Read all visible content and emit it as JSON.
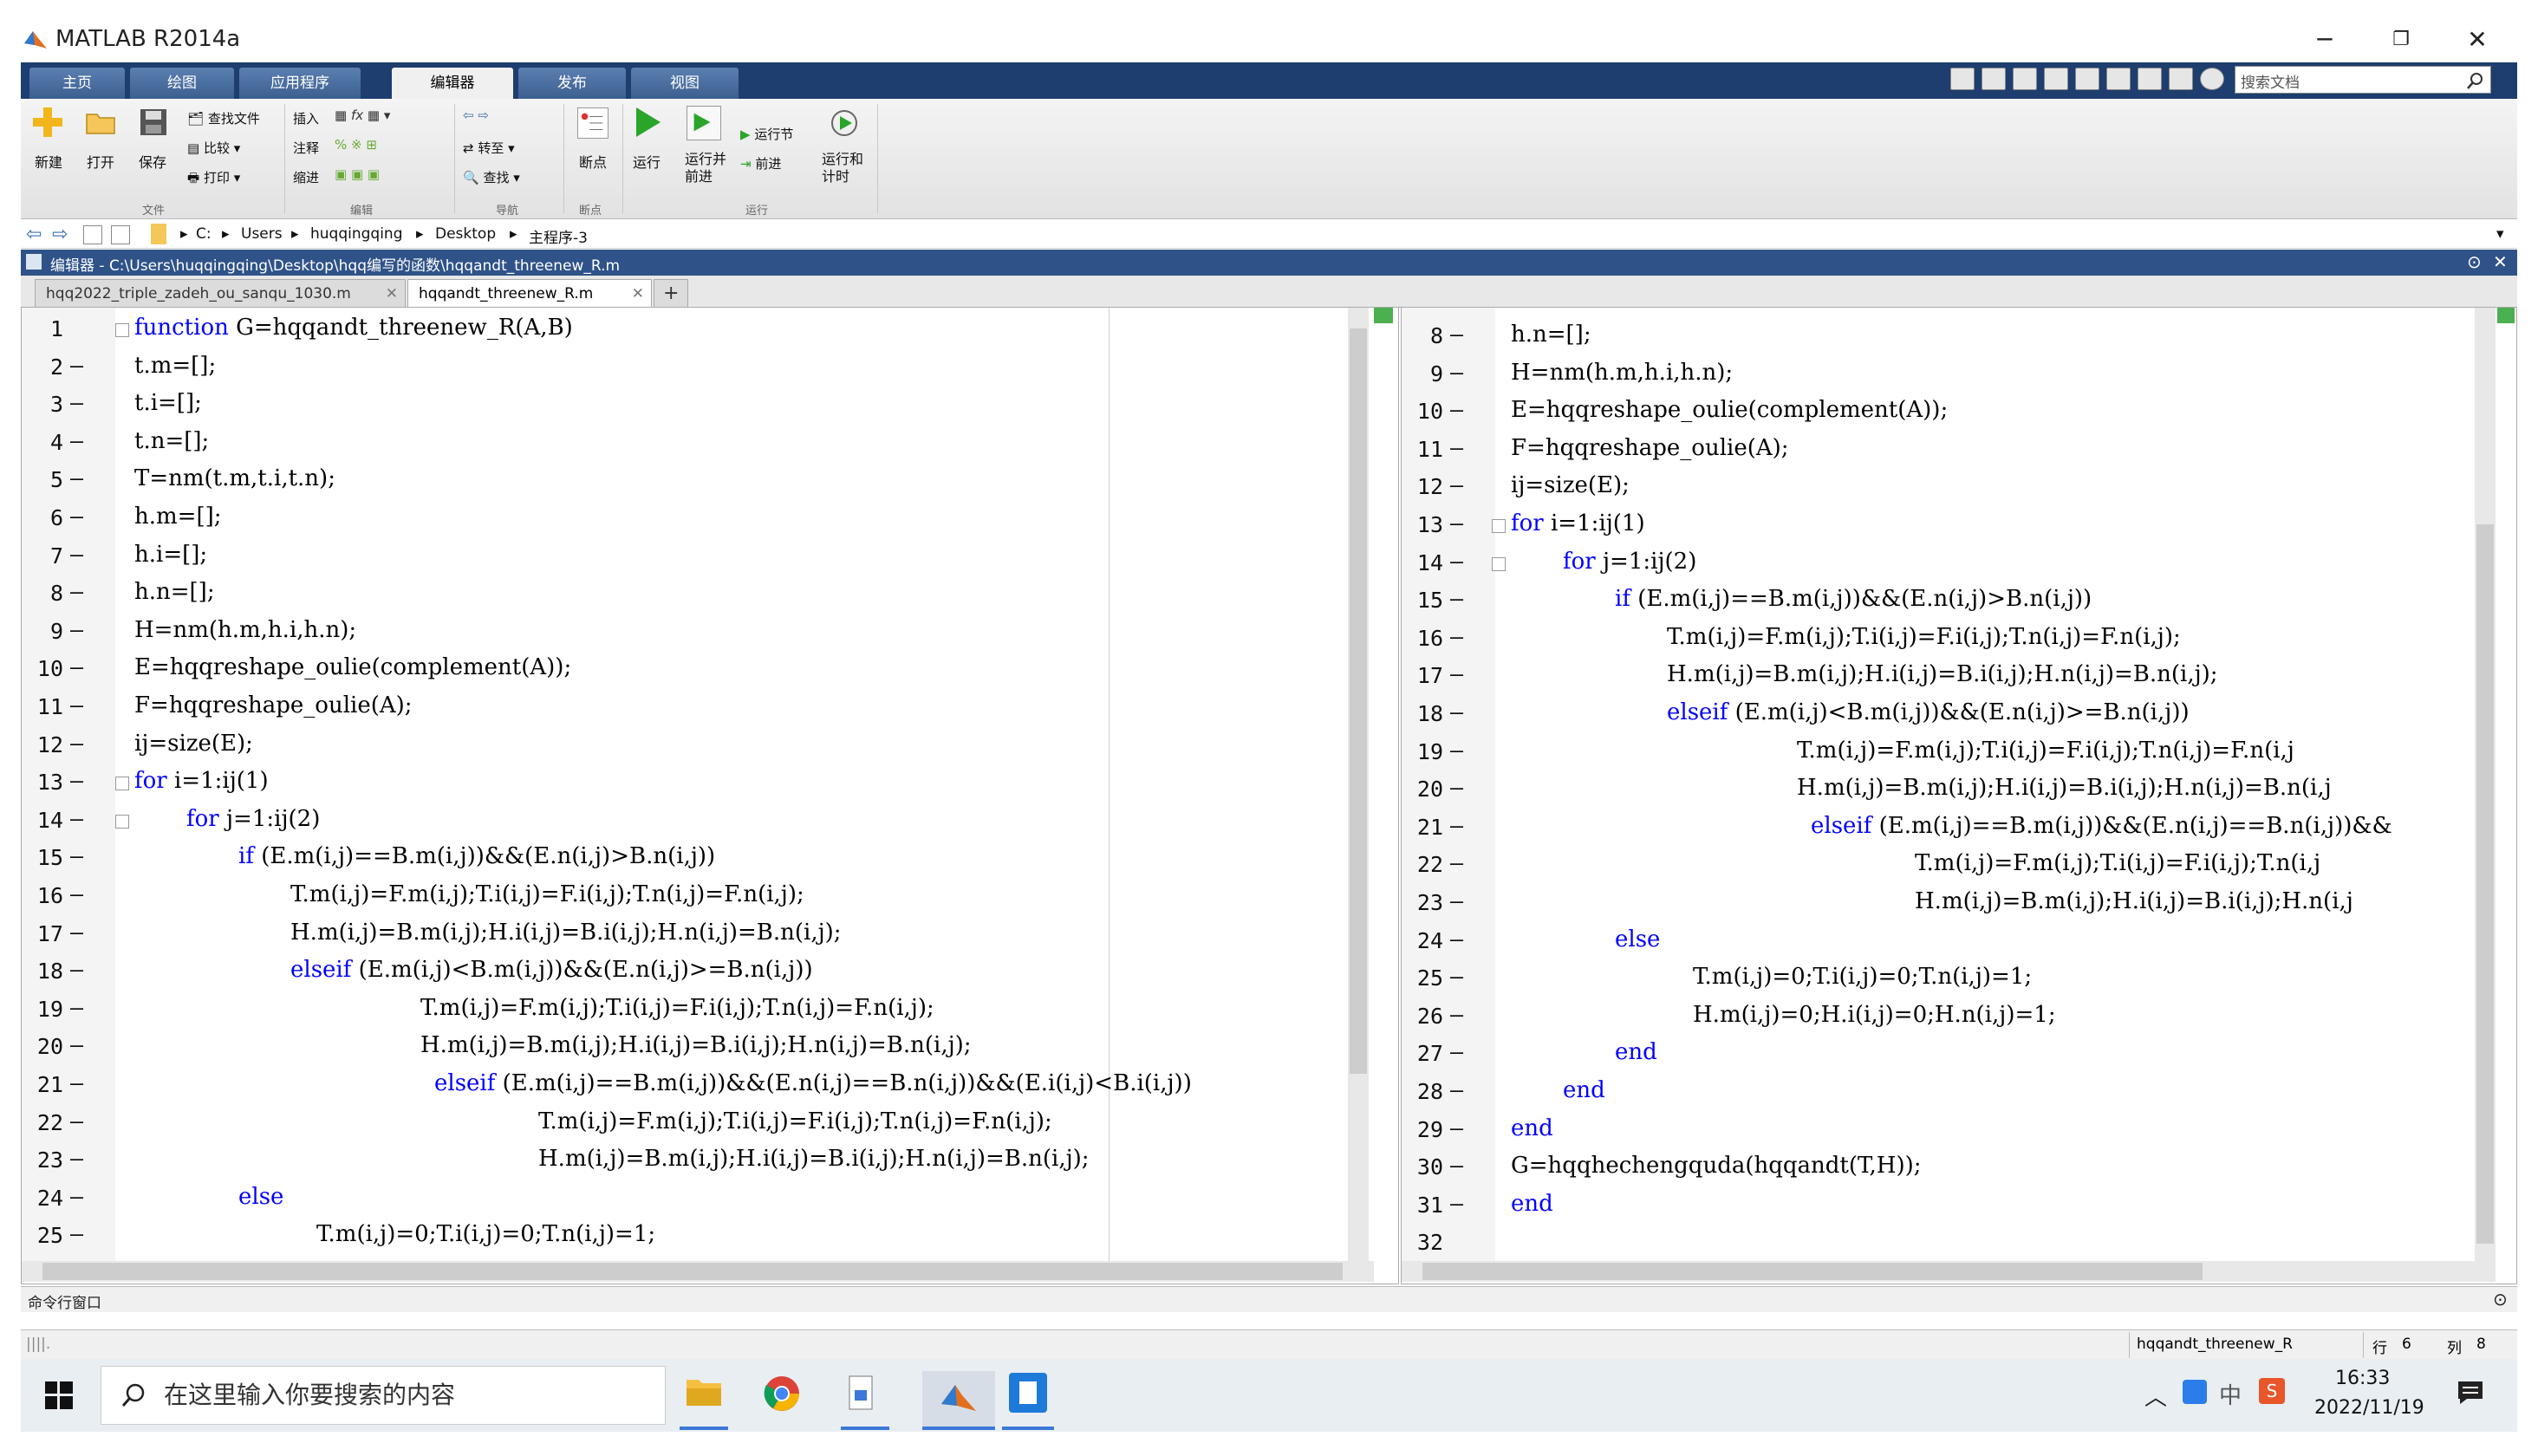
{
  "window": {
    "title": "MATLAB R2014a"
  },
  "ribbon_tabs": [
    "主页",
    "绘图",
    "应用程序",
    "编辑器",
    "发布",
    "视图"
  ],
  "search_placeholder": "搜索文档",
  "ribbon": {
    "file": {
      "new": "新建",
      "open": "打开",
      "save": "保存",
      "find_files": "查找文件",
      "compare": "比较",
      "print": "打印",
      "group": "文件"
    },
    "edit": {
      "insert": "插入",
      "comment": "注释",
      "indent": "缩进",
      "group": "编辑"
    },
    "navigate": {
      "goto": "转至",
      "find": "查找",
      "group": "导航"
    },
    "breakpoints": {
      "label": "断点",
      "group": "断点"
    },
    "run": {
      "run": "运行",
      "run_advance": "运行并\n前进",
      "run_section": "运行节",
      "advance": "前进",
      "run_time": "运行和\n计时",
      "group": "运行"
    }
  },
  "address": [
    "C:",
    "Users",
    "huqqingqing",
    "Desktop",
    "主程序-3"
  ],
  "editor_header": "编辑器 - C:\\Users\\huqqingqing\\Desktop\\hqq编写的函数\\hqqandt_threenew_R.m",
  "file_tabs": [
    "hqq2022_triple_zadeh_ou_sanqu_1030.m",
    "hqqandt_threenew_R.m",
    "+"
  ],
  "left_pane": {
    "lines": [
      {
        "n": "1",
        "dash": "",
        "indent": 0,
        "kw": "function",
        "text": " G=hqqandt_threenew_R(A,B)",
        "fold": true
      },
      {
        "n": "2",
        "dash": "—",
        "indent": 0,
        "kw": "",
        "text": "t.m=[];"
      },
      {
        "n": "3",
        "dash": "—",
        "indent": 0,
        "kw": "",
        "text": "t.i=[];"
      },
      {
        "n": "4",
        "dash": "—",
        "indent": 0,
        "kw": "",
        "text": "t.n=[];"
      },
      {
        "n": "5",
        "dash": "—",
        "indent": 0,
        "kw": "",
        "text": "T=nm(t.m,t.i,t.n);"
      },
      {
        "n": "6",
        "dash": "—",
        "indent": 0,
        "kw": "",
        "text": "h.m=[];"
      },
      {
        "n": "7",
        "dash": "—",
        "indent": 0,
        "kw": "",
        "text": "h.i=[];"
      },
      {
        "n": "8",
        "dash": "—",
        "indent": 0,
        "kw": "",
        "text": "h.n=[];"
      },
      {
        "n": "9",
        "dash": "—",
        "indent": 0,
        "kw": "",
        "text": "H=nm(h.m,h.i,h.n);"
      },
      {
        "n": "10",
        "dash": "—",
        "indent": 0,
        "kw": "",
        "text": "E=hqqreshape_oulie(complement(A));"
      },
      {
        "n": "11",
        "dash": "—",
        "indent": 0,
        "kw": "",
        "text": "F=hqqreshape_oulie(A);"
      },
      {
        "n": "12",
        "dash": "—",
        "indent": 0,
        "kw": "",
        "text": "ij=size(E);"
      },
      {
        "n": "13",
        "dash": "—",
        "indent": 0,
        "kw": "for",
        "text": " i=1:ij(1)",
        "fold": true
      },
      {
        "n": "14",
        "dash": "—",
        "indent": 60,
        "kw": "for",
        "text": " j=1:ij(2)",
        "fold": true
      },
      {
        "n": "15",
        "dash": "—",
        "indent": 120,
        "kw": "if",
        "text": " (E.m(i,j)==B.m(i,j))&&(E.n(i,j)>B.n(i,j))"
      },
      {
        "n": "16",
        "dash": "—",
        "indent": 180,
        "kw": "",
        "text": "T.m(i,j)=F.m(i,j);T.i(i,j)=F.i(i,j);T.n(i,j)=F.n(i,j);"
      },
      {
        "n": "17",
        "dash": "—",
        "indent": 180,
        "kw": "",
        "text": "H.m(i,j)=B.m(i,j);H.i(i,j)=B.i(i,j);H.n(i,j)=B.n(i,j);"
      },
      {
        "n": "18",
        "dash": "—",
        "indent": 180,
        "kw": "elseif",
        "text": " (E.m(i,j)<B.m(i,j))&&(E.n(i,j)>=B.n(i,j))"
      },
      {
        "n": "19",
        "dash": "—",
        "indent": 330,
        "kw": "",
        "text": "T.m(i,j)=F.m(i,j);T.i(i,j)=F.i(i,j);T.n(i,j)=F.n(i,j);"
      },
      {
        "n": "20",
        "dash": "—",
        "indent": 330,
        "kw": "",
        "text": "H.m(i,j)=B.m(i,j);H.i(i,j)=B.i(i,j);H.n(i,j)=B.n(i,j);"
      },
      {
        "n": "21",
        "dash": "—",
        "indent": 346,
        "kw": "elseif",
        "text": " (E.m(i,j)==B.m(i,j))&&(E.n(i,j)==B.n(i,j))&&(E.i(i,j)<B.i(i,j))"
      },
      {
        "n": "22",
        "dash": "—",
        "indent": 466,
        "kw": "",
        "text": "T.m(i,j)=F.m(i,j);T.i(i,j)=F.i(i,j);T.n(i,j)=F.n(i,j);"
      },
      {
        "n": "23",
        "dash": "—",
        "indent": 466,
        "kw": "",
        "text": "H.m(i,j)=B.m(i,j);H.i(i,j)=B.i(i,j);H.n(i,j)=B.n(i,j);"
      },
      {
        "n": "24",
        "dash": "—",
        "indent": 120,
        "kw": "else",
        "text": ""
      },
      {
        "n": "25",
        "dash": "—",
        "indent": 210,
        "kw": "",
        "text": "T.m(i,j)=0;T.i(i,j)=0;T.n(i,j)=1;"
      }
    ]
  },
  "right_pane": {
    "lines": [
      {
        "n": "8",
        "dash": "—",
        "indent": 0,
        "kw": "",
        "text": "h.n=[];"
      },
      {
        "n": "9",
        "dash": "—",
        "indent": 0,
        "kw": "",
        "text": "H=nm(h.m,h.i,h.n);"
      },
      {
        "n": "10",
        "dash": "—",
        "indent": 0,
        "kw": "",
        "text": "E=hqqreshape_oulie(complement(A));"
      },
      {
        "n": "11",
        "dash": "—",
        "indent": 0,
        "kw": "",
        "text": "F=hqqreshape_oulie(A);"
      },
      {
        "n": "12",
        "dash": "—",
        "indent": 0,
        "kw": "",
        "text": "ij=size(E);"
      },
      {
        "n": "13",
        "dash": "—",
        "indent": 0,
        "kw": "for",
        "text": " i=1:ij(1)",
        "fold": true
      },
      {
        "n": "14",
        "dash": "—",
        "indent": 60,
        "kw": "for",
        "text": " j=1:ij(2)",
        "fold": true
      },
      {
        "n": "15",
        "dash": "—",
        "indent": 120,
        "kw": "if",
        "text": " (E.m(i,j)==B.m(i,j))&&(E.n(i,j)>B.n(i,j))"
      },
      {
        "n": "16",
        "dash": "—",
        "indent": 180,
        "kw": "",
        "text": "T.m(i,j)=F.m(i,j);T.i(i,j)=F.i(i,j);T.n(i,j)=F.n(i,j);"
      },
      {
        "n": "17",
        "dash": "—",
        "indent": 180,
        "kw": "",
        "text": "H.m(i,j)=B.m(i,j);H.i(i,j)=B.i(i,j);H.n(i,j)=B.n(i,j);"
      },
      {
        "n": "18",
        "dash": "—",
        "indent": 180,
        "kw": "elseif",
        "text": " (E.m(i,j)<B.m(i,j))&&(E.n(i,j)>=B.n(i,j))"
      },
      {
        "n": "19",
        "dash": "—",
        "indent": 330,
        "kw": "",
        "text": "T.m(i,j)=F.m(i,j);T.i(i,j)=F.i(i,j);T.n(i,j)=F.n(i,j"
      },
      {
        "n": "20",
        "dash": "—",
        "indent": 330,
        "kw": "",
        "text": "H.m(i,j)=B.m(i,j);H.i(i,j)=B.i(i,j);H.n(i,j)=B.n(i,j"
      },
      {
        "n": "21",
        "dash": "—",
        "indent": 346,
        "kw": "elseif",
        "text": " (E.m(i,j)==B.m(i,j))&&(E.n(i,j)==B.n(i,j))&&"
      },
      {
        "n": "22",
        "dash": "—",
        "indent": 466,
        "kw": "",
        "text": "T.m(i,j)=F.m(i,j);T.i(i,j)=F.i(i,j);T.n(i,j"
      },
      {
        "n": "23",
        "dash": "—",
        "indent": 466,
        "kw": "",
        "text": "H.m(i,j)=B.m(i,j);H.i(i,j)=B.i(i,j);H.n(i,j"
      },
      {
        "n": "24",
        "dash": "—",
        "indent": 120,
        "kw": "else",
        "text": ""
      },
      {
        "n": "25",
        "dash": "—",
        "indent": 210,
        "kw": "",
        "text": "T.m(i,j)=0;T.i(i,j)=0;T.n(i,j)=1;"
      },
      {
        "n": "26",
        "dash": "—",
        "indent": 210,
        "kw": "",
        "text": "H.m(i,j)=0;H.i(i,j)=0;H.n(i,j)=1;"
      },
      {
        "n": "27",
        "dash": "—",
        "indent": 120,
        "kw": "end",
        "text": ""
      },
      {
        "n": "28",
        "dash": "—",
        "indent": 60,
        "kw": "end",
        "text": ""
      },
      {
        "n": "29",
        "dash": "—",
        "indent": 0,
        "kw": "end",
        "text": ""
      },
      {
        "n": "30",
        "dash": "—",
        "indent": 0,
        "kw": "",
        "text": "G=hqqhechengquda(hqqandt(T,H));"
      },
      {
        "n": "31",
        "dash": "—",
        "indent": 0,
        "kw": "end",
        "text": ""
      },
      {
        "n": "32",
        "dash": "",
        "indent": 0,
        "kw": "",
        "text": ""
      }
    ]
  },
  "command_window": {
    "title": "命令行窗口"
  },
  "status": {
    "file": "hqqandt_threenew_R",
    "row_label": "行",
    "row": "6",
    "col_label": "列",
    "col": "8"
  },
  "taskbar": {
    "search_placeholder": "在这里输入你要搜索的内容",
    "time": "16:33",
    "date": "2022/11/19",
    "ime": "中"
  },
  "colors": {
    "tab_bar": "#1d3e6e",
    "editor_header": "#2f5388",
    "keyword": "#0000ff"
  }
}
